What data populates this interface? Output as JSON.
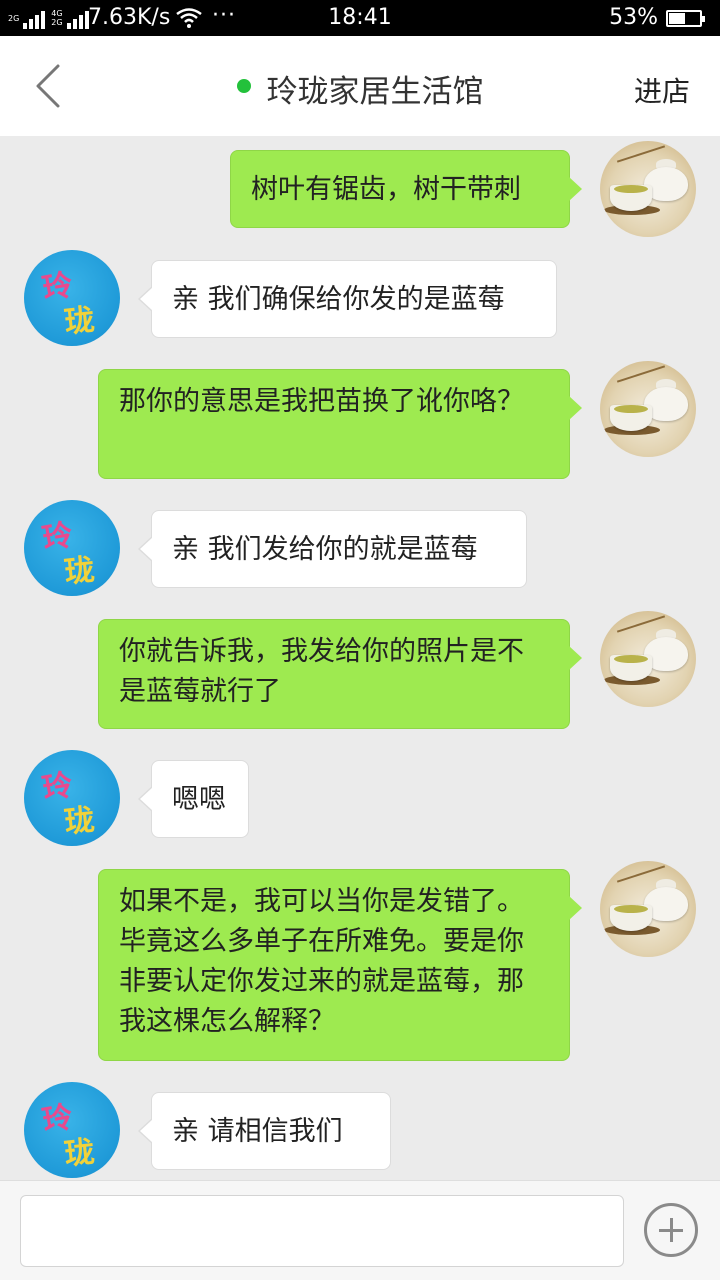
{
  "status_bar": {
    "sim1_label": "2G",
    "sim2_label_top": "4G",
    "sim2_label_bottom": "2G",
    "network_speed": "7.63K/s",
    "more_dots": "···",
    "time": "18:41",
    "battery_percent": "53%",
    "battery_level": 0.53
  },
  "header": {
    "title": "玲珑家居生活馆",
    "enter_shop_label": "进店",
    "online_color": "#23c13b"
  },
  "messages": [
    {
      "from": "me",
      "text": "树叶有锯齿，树干带刺"
    },
    {
      "from": "store",
      "text": "亲 我们确保给你发的是蓝莓"
    },
    {
      "from": "me",
      "text": "那你的意思是我把苗换了讹你咯？"
    },
    {
      "from": "store",
      "text": "亲 我们发给你的就是蓝莓"
    },
    {
      "from": "me",
      "text": "你就告诉我，我发给你的照片是不是蓝莓就行了"
    },
    {
      "from": "store",
      "text": "嗯嗯"
    },
    {
      "from": "me",
      "text": "如果不是，我可以当你是发错了。毕竟这么多单子在所难免。要是你非要认定你发过来的就是蓝莓，那我这棵怎么解释？"
    },
    {
      "from": "store",
      "text": "亲  请相信我们"
    }
  ],
  "store_avatar": {
    "char1": "玲",
    "char2": "珑"
  },
  "input_bar": {
    "placeholder": ""
  },
  "colors": {
    "my_bubble": "#9eea50",
    "their_bubble": "#ffffff",
    "background": "#ebebeb"
  },
  "icons": [
    "back-arrow-icon",
    "plus-icon",
    "wifi-icon",
    "signal-icon",
    "battery-icon"
  ]
}
